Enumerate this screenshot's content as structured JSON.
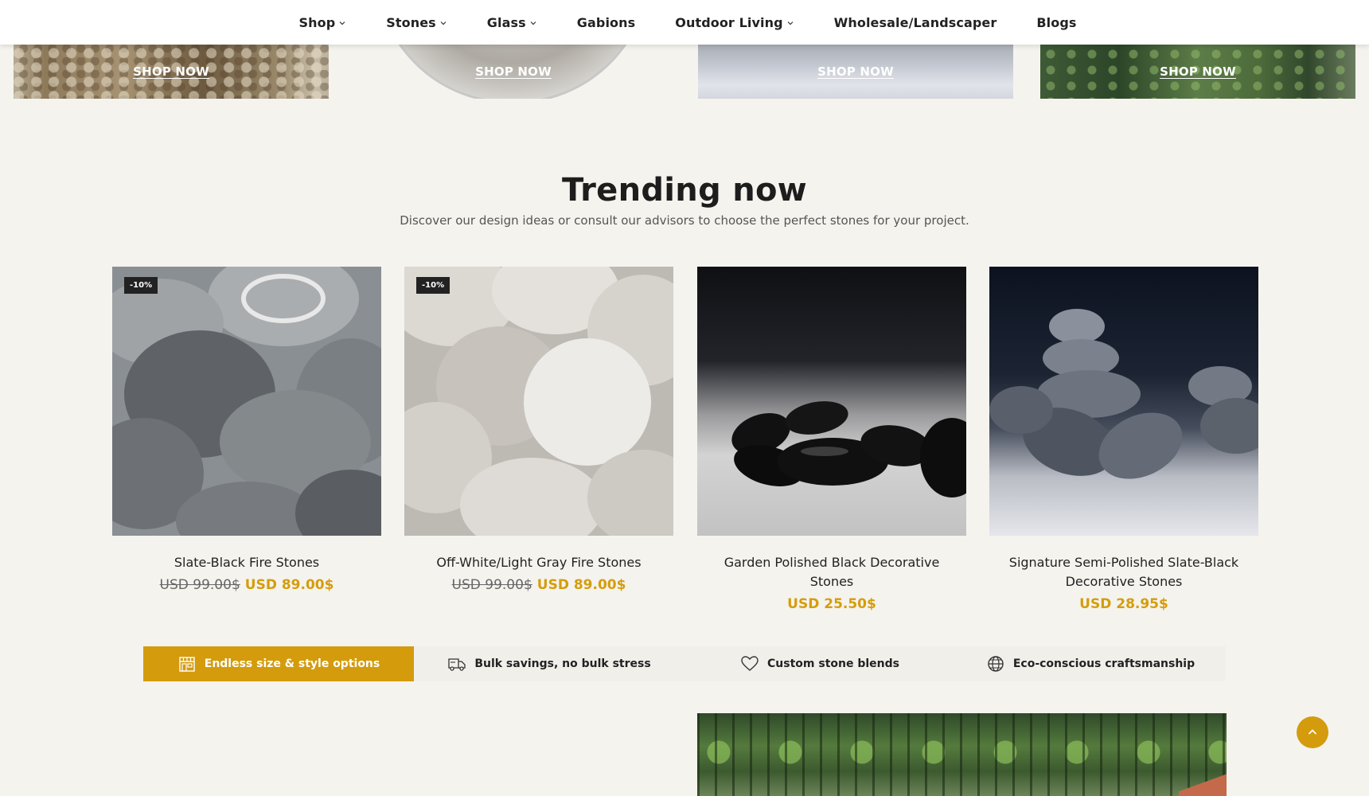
{
  "nav": {
    "items": [
      {
        "label": "Shop",
        "dropdown": true
      },
      {
        "label": "Stones",
        "dropdown": true
      },
      {
        "label": "Glass",
        "dropdown": true
      },
      {
        "label": "Gabions",
        "dropdown": false
      },
      {
        "label": "Outdoor Living",
        "dropdown": true
      },
      {
        "label": "Wholesale/Landscaper",
        "dropdown": false
      },
      {
        "label": "Blogs",
        "dropdown": false
      }
    ]
  },
  "banners": [
    {
      "link": "SHOP NOW"
    },
    {
      "link": "SHOP NOW"
    },
    {
      "link": "SHOP NOW"
    },
    {
      "link": "SHOP NOW"
    }
  ],
  "trending": {
    "title": "Trending now",
    "subtitle": "Discover our design ideas or consult our advisors to choose the perfect stones for your project."
  },
  "products": [
    {
      "name": "Slate-Black Fire Stones",
      "badge": "-10%",
      "old_price": "USD 99.00$",
      "price": "USD 89.00$"
    },
    {
      "name": "Off-White/Light Gray Fire Stones",
      "badge": "-10%",
      "old_price": "USD 99.00$",
      "price": "USD 89.00$"
    },
    {
      "name": "Garden Polished Black Decorative Stones",
      "price": "USD 25.50$"
    },
    {
      "name": "Signature Semi-Polished Slate-Black Decorative Stones",
      "price": "USD 28.95$"
    }
  ],
  "features": [
    {
      "label": "Endless size & style options",
      "icon": "storefront-icon",
      "active": true
    },
    {
      "label": "Bulk savings, no bulk stress",
      "icon": "truck-icon"
    },
    {
      "label": "Custom stone blends",
      "icon": "heart-icon"
    },
    {
      "label": "Eco-conscious craftsmanship",
      "icon": "globe-icon"
    }
  ],
  "colors": {
    "accent": "#d49b0d",
    "background": "#f5f3ee",
    "nav_bg": "#ffffff"
  },
  "icons": {
    "back_to_top": "chevron-up-icon",
    "dropdown": "chevron-down-icon"
  }
}
